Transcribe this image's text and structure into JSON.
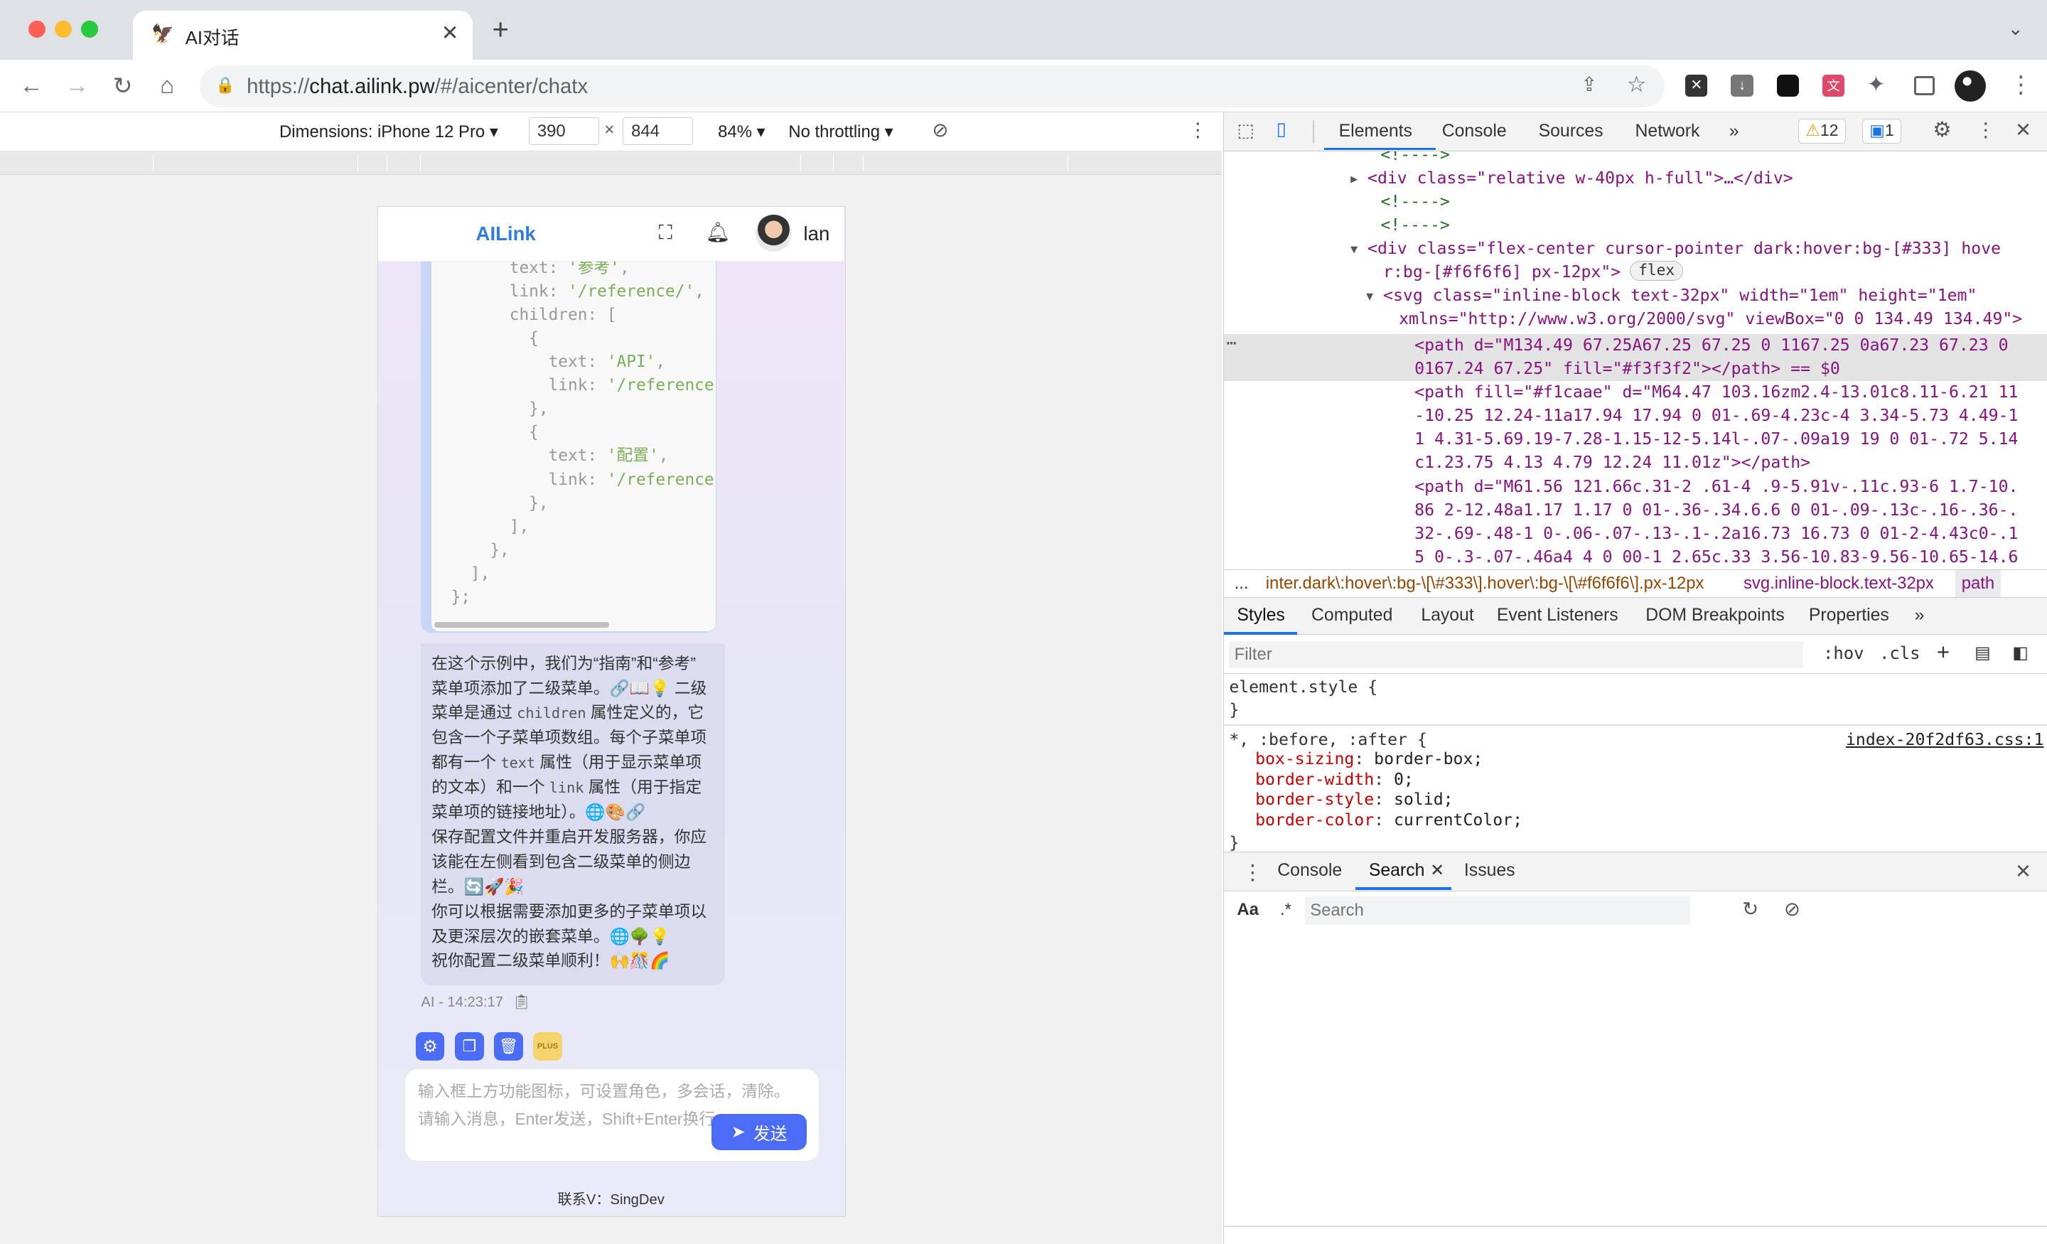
{
  "browser": {
    "tab_title": "AI对话",
    "new_tab": "+",
    "url_prefix": "https://",
    "url_host": "chat.ailink.pw",
    "url_path": "/#/aicenter/chatx"
  },
  "device_toolbar": {
    "dimensions_label": "Dimensions: iPhone 12 Pro",
    "width": "390",
    "times": "×",
    "height": "844",
    "zoom": "84%",
    "throttling": "No throttling"
  },
  "app": {
    "logo": "AILink",
    "username": "lan",
    "code_lines": [
      {
        "indent": "        ",
        "key": "text: ",
        "val": "'参考'",
        "tail": ","
      },
      {
        "indent": "        ",
        "key": "link: ",
        "val": "'/reference/'",
        "tail": ","
      },
      {
        "indent": "        ",
        "key": "children: [",
        "val": "",
        "tail": ""
      },
      {
        "indent": "          ",
        "key": "{",
        "val": "",
        "tail": ""
      },
      {
        "indent": "            ",
        "key": "text: ",
        "val": "'API'",
        "tail": ","
      },
      {
        "indent": "            ",
        "key": "link: ",
        "val": "'/reference",
        "tail": ""
      },
      {
        "indent": "          ",
        "key": "},",
        "val": "",
        "tail": ""
      },
      {
        "indent": "          ",
        "key": "{",
        "val": "",
        "tail": ""
      },
      {
        "indent": "            ",
        "key": "text: ",
        "val": "'配置'",
        "tail": ","
      },
      {
        "indent": "            ",
        "key": "link: ",
        "val": "'/reference",
        "tail": ""
      },
      {
        "indent": "          ",
        "key": "},",
        "val": "",
        "tail": ""
      },
      {
        "indent": "        ",
        "key": "],",
        "val": "",
        "tail": ""
      },
      {
        "indent": "      ",
        "key": "},",
        "val": "",
        "tail": ""
      },
      {
        "indent": "    ",
        "key": "],",
        "val": "",
        "tail": ""
      },
      {
        "indent": "  ",
        "key": "};",
        "val": "",
        "tail": ""
      }
    ],
    "message": {
      "l1": "在这个示例中，我们为“指南”和“参考”",
      "l2": "菜单项添加了二级菜单。🔗📖💡 二级",
      "l3a": "菜单是通过 ",
      "l3code": "children",
      "l3b": " 属性定义的，它",
      "l4": "包含一个子菜单项数组。每个子菜单项",
      "l5a": "都有一个 ",
      "l5code": "text",
      "l5b": " 属性（用于显示菜单项",
      "l6a": "的文本）和一个 ",
      "l6code": "link",
      "l6b": " 属性（用于指定",
      "l7": "菜单项的链接地址）。🌐🎨🔗",
      "l8": "保存配置文件并重启开发服务器，你应",
      "l9": "该能在左侧看到包含二级菜单的侧边",
      "l10": "栏。🔄🚀🎉",
      "l11": "你可以根据需要添加更多的子菜单项以",
      "l12": "及更深层次的嵌套菜单。🌐🌳💡",
      "l13": "祝你配置二级菜单顺利！🙌🎊🌈"
    },
    "meta": "AI - 14:23:17",
    "plus_badge": "PLUS",
    "input_placeholder_1": "输入框上方功能图标，可设置角色，多会话，清除。",
    "input_placeholder_2": "请输入消息，Enter发送，Shift+Enter换行",
    "send_label": "发送",
    "footer": "联系V：SingDev"
  },
  "devtools": {
    "tabs": [
      "Elements",
      "Console",
      "Sources",
      "Network"
    ],
    "more": "»",
    "warnings": "12",
    "messages": "1",
    "breadcrumb": [
      "...",
      "inter.dark\\:hover\\:bg-\\[\\#333\\].hover\\:bg-\\[\\#f6f6f6\\].px-12px",
      "svg.inline-block.text-32px",
      "path"
    ],
    "subtabs": [
      "Styles",
      "Computed",
      "Layout",
      "Event Listeners",
      "DOM Breakpoints",
      "Properties",
      "»"
    ],
    "filter_placeholder": "Filter",
    "hov": ":hov",
    "cls": ".cls",
    "element_style": "element.style {",
    "close_brace": "}",
    "rule_selector": "*, :before, :after {",
    "rule_source": "index-20f2df63.css:1",
    "props": [
      {
        "name": "box-sizing",
        "value": "border-box;"
      },
      {
        "name": "border-width",
        "value": "0;"
      },
      {
        "name": "border-style",
        "value": "solid;"
      },
      {
        "name": "border-color",
        "value": "currentColor;"
      }
    ],
    "drawer_tabs": [
      "Console",
      "Search",
      "Issues"
    ],
    "search_aa": "Aa",
    "search_regex": ".*",
    "search_placeholder": "Search",
    "html_lines": [
      {
        "t": "<!---->"
      },
      {
        "t": "<div class=\"relative w-40px h-full\">…</div>"
      },
      {
        "t": "<!---->"
      },
      {
        "t": "<!---->"
      },
      {
        "t": "<div class=\"flex-center cursor-pointer dark:hover:bg-[#333] hove"
      },
      {
        "t": "r:bg-[#f6f6f6] px-12px\">"
      },
      {
        "t": "<svg class=\"inline-block text-32px\" width=\"1em\" height=\"1em\""
      },
      {
        "t": "xmlns=\"http://www.w3.org/2000/svg\" viewBox=\"0 0 134.49 134.49\">"
      },
      {
        "t": "<path d=\"M134.49 67.25A67.25 67.25 0 1167.25 0a67.23 67.23 0"
      },
      {
        "t": "0167.24 67.25\" fill=\"#f3f3f2\"></path> == $0"
      },
      {
        "t": "<path fill=\"#f1caae\" d=\"M64.47 103.16zm2.4-13.01c8.11-6.21 11"
      },
      {
        "t": "-10.25 12.24-11a17.94 17.94 0 01-.69-4.23c-4 3.34-5.73 4.49-1"
      },
      {
        "t": "1 4.31-5.69.19-7.28-1.15-12-5.14l-.07-.09a19 19 0 01-.72 5.14"
      },
      {
        "t": "c1.23.75 4.13 4.79 12.24 11.01z\"></path>"
      },
      {
        "t": "<path d=\"M61.56 121.66c.31-2 .61-4 .9-5.91v-.11c.93-6 1.7-10."
      },
      {
        "t": "86 2-12.48a1.17 1.17 0 01-.36-.34.6.6 0 01-.09-.13c-.16-.36-."
      },
      {
        "t": "32-.69-.48-1 0-.06-.07-.13-.1-.2a16.73 16.73 0 01-2-4.43c0-.1"
      },
      {
        "t": "5 0-.3-.07-.46a4 4 0 00-1 2.65c.33 3.56-10.83-9.56-10.65-14.6"
      }
    ],
    "flex_badge": "flex"
  },
  "colors": {
    "accent": "#1a73e8",
    "send_button": "#4a6cf7",
    "plus_badge": "#f5d46b"
  }
}
